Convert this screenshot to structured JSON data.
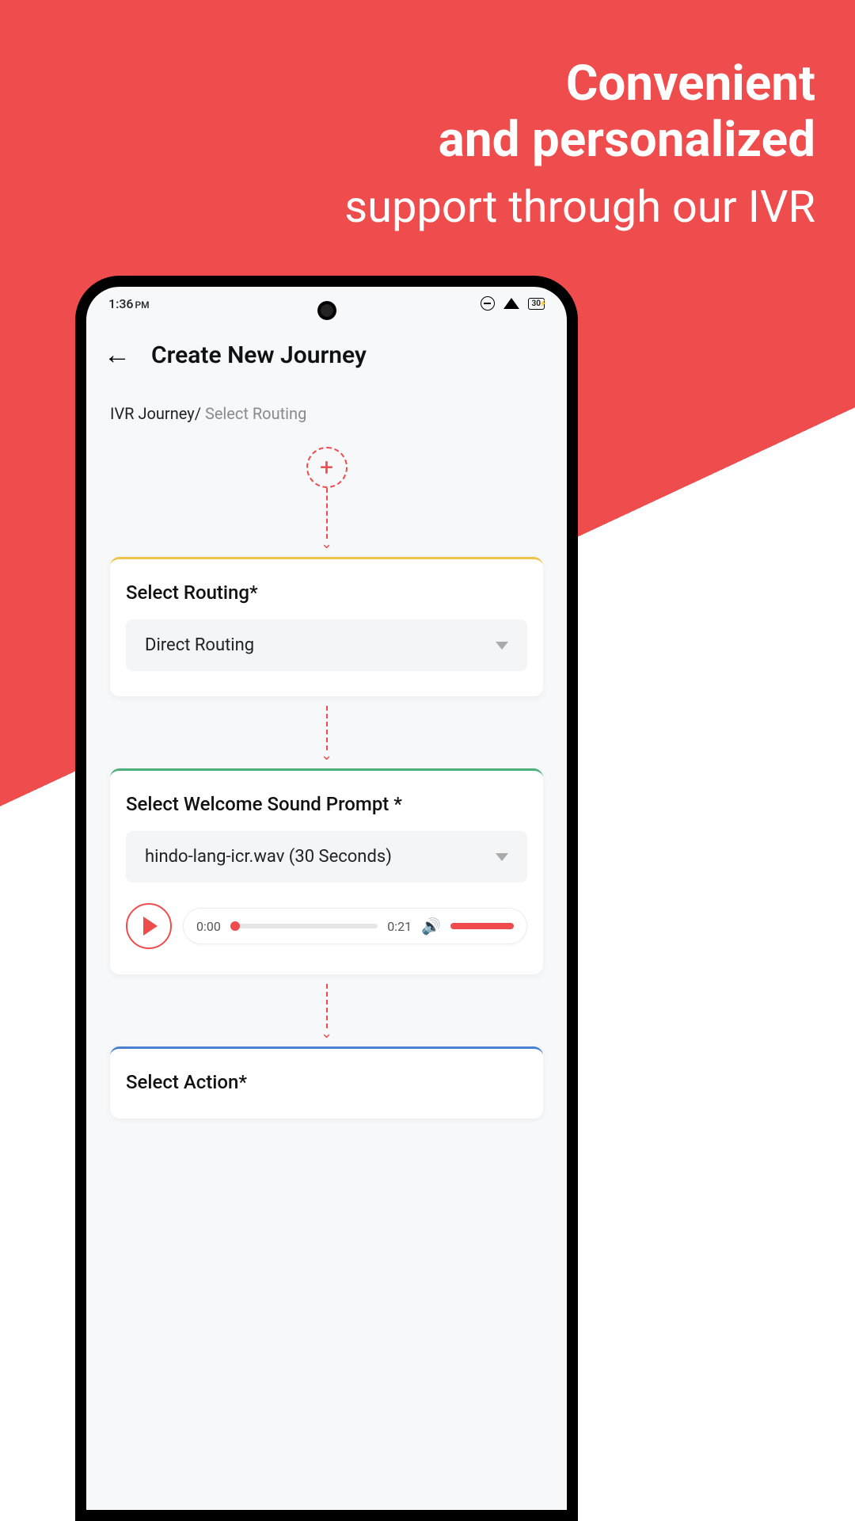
{
  "marketing": {
    "line1": "Convenient",
    "line2": "and personalized",
    "line3": "support through our IVR"
  },
  "statusBar": {
    "time": "1:36",
    "timeSuffix": "PM",
    "batteryPercent": "30"
  },
  "header": {
    "title": "Create New Journey"
  },
  "breadcrumb": {
    "root": "IVR Journey",
    "separator": "/",
    "current": "Select Routing"
  },
  "cards": {
    "routing": {
      "label": "Select Routing*",
      "selected": "Direct Routing"
    },
    "welcome": {
      "label": "Select Welcome Sound Prompt *",
      "selected": "hindo-lang-icr.wav (30 Seconds)",
      "audio": {
        "current": "0:00",
        "duration": "0:21"
      }
    },
    "action": {
      "label": "Select Action*"
    }
  }
}
